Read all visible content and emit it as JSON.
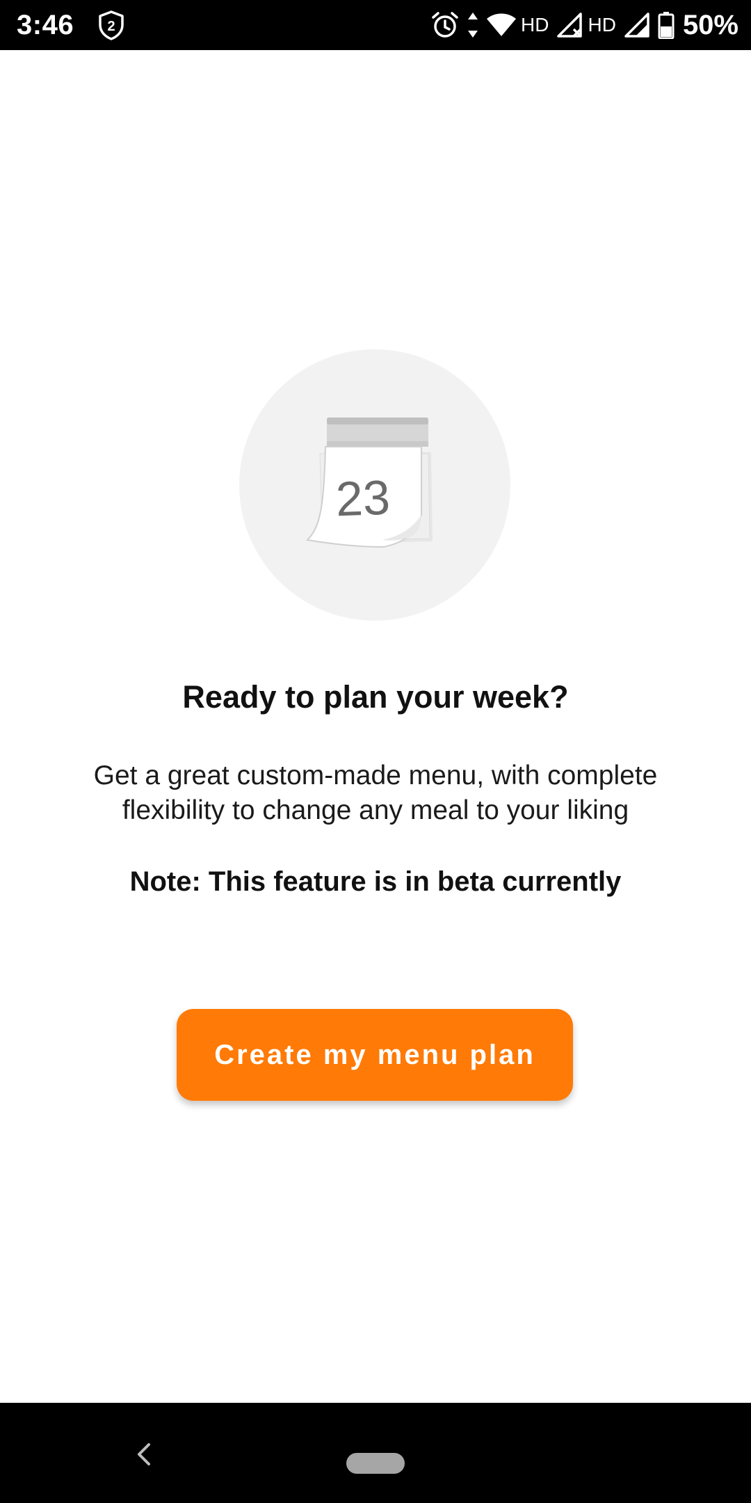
{
  "status_bar": {
    "time": "3:46",
    "shield_badge": "2",
    "network_label_1": "HD",
    "network_label_2": "HD",
    "battery": "50%",
    "icons": [
      "shield-badge-icon",
      "alarm-icon",
      "data-arrows-icon",
      "wifi-icon",
      "signal-x-icon",
      "signal-icon",
      "battery-icon"
    ]
  },
  "main": {
    "illustration": {
      "icon": "calendar-icon",
      "day_number": "23"
    },
    "headline": "Ready to plan your week?",
    "description": "Get a great custom-made menu, with complete flexibility to change any meal to your liking",
    "note": "Note: This feature is in beta currently",
    "cta_label": "Create my menu plan",
    "accent_color": "#ff7a06"
  },
  "nav_bar": {
    "icons": [
      "back-icon",
      "home-pill-icon"
    ]
  }
}
